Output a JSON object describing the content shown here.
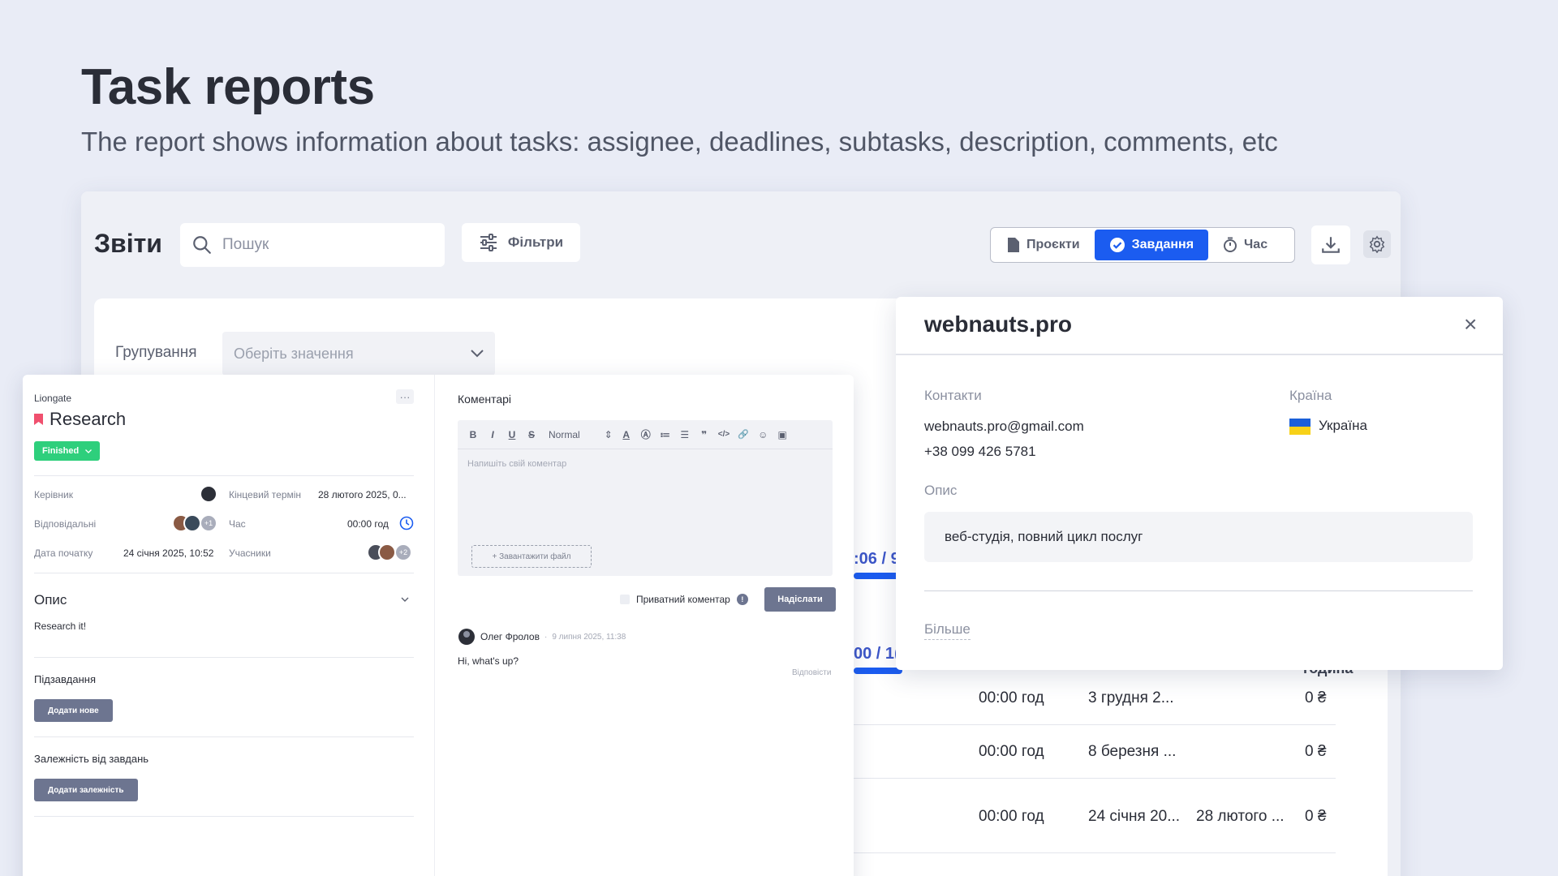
{
  "hero": {
    "title": "Task reports",
    "subtitle": "The report shows information about tasks: assignee, deadlines, subtasks, description, comments, etc"
  },
  "app": {
    "title": "Звіти",
    "search_placeholder": "Пошук",
    "filters_label": "Фільтри",
    "tabs": [
      {
        "label": "Проєкти",
        "active": false
      },
      {
        "label": "Завдання",
        "active": true
      },
      {
        "label": "Час",
        "active": false
      }
    ],
    "grouping_label": "Групування",
    "grouping_placeholder": "Оберіть значення",
    "progress": [
      {
        "text": ":06 / 9"
      },
      {
        "text": "00 / 1("
      }
    ],
    "column_header": "година",
    "rows": [
      {
        "time": "00:00 год",
        "date1": "3 грудня 2...",
        "date2": "",
        "amount": "0 ₴"
      },
      {
        "time": "00:00 год",
        "date1": "8 березня ...",
        "date2": "",
        "amount": "0 ₴"
      },
      {
        "time": "00:00 год",
        "date1": "24 січня 20...",
        "date2": "28 лютого ...",
        "amount": "0 ₴"
      }
    ]
  },
  "task": {
    "project": "Liongate",
    "more": "···",
    "title": "Research",
    "status": "Finished",
    "fields": {
      "manager_label": "Керівник",
      "deadline_label": "Кінцевий термін",
      "deadline_value": "28 лютого 2025, 0...",
      "assignees_label": "Відповідальні",
      "assignees_more": "+1",
      "time_label": "Час",
      "time_value": "00:00 год",
      "start_label": "Дата початку",
      "start_value": "24 січня 2025, 10:52",
      "members_label": "Учасники",
      "members_more": "+2"
    },
    "description_title": "Опис",
    "description_text": "Research it!",
    "subtasks_title": "Підзавдання",
    "add_subtask": "Додати нове",
    "dependencies_title": "Залежність від завдань",
    "add_dependency": "Додати залежність"
  },
  "comments": {
    "title": "Коментарі",
    "toolbar": [
      "B",
      "I",
      "U",
      "S",
      "Normal",
      "⇕",
      "A",
      "Ⓐ",
      "≔",
      "☰",
      "❞",
      "</>",
      "🔗",
      "☺",
      "▣"
    ],
    "placeholder": "Напишіть свій коментар",
    "upload_label": "+ Завантажити файл",
    "private_label": "Приватний коментар",
    "info": "!",
    "send_label": "Надіслати",
    "items": [
      {
        "author": "Олег Фролов",
        "sep": "·",
        "date": "9 липня 2025, 11:38",
        "text": "Hi, what's up?",
        "reply": "Відповісти"
      }
    ]
  },
  "company": {
    "title": "webnauts.pro",
    "close": "×",
    "contacts_label": "Контакти",
    "email": "webnauts.pro@gmail.com",
    "phone": "+38 099 426 5781",
    "country_label": "Країна",
    "country": "Україна",
    "description_label": "Опис",
    "description": "веб-студія, повний цикл послуг",
    "more": "Більше"
  },
  "colors": {
    "accent": "#1b5cf0",
    "status_finished": "#2ecf7c",
    "bookmark": "#f0506e"
  }
}
